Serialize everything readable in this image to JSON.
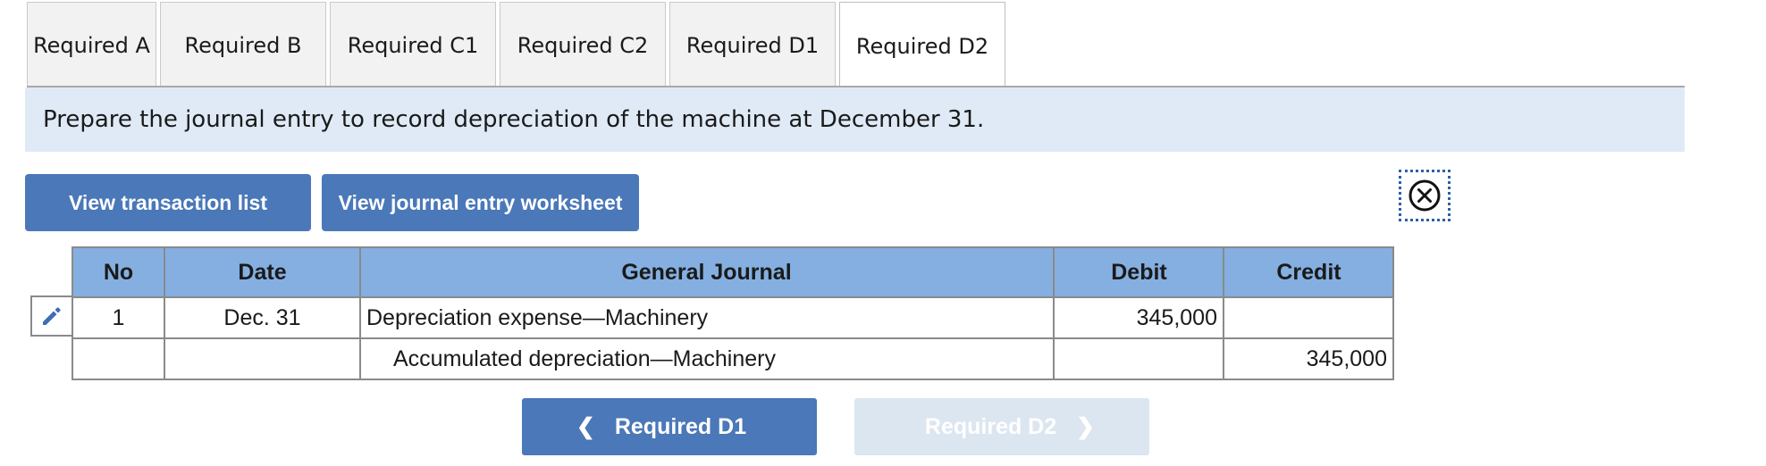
{
  "tabs": [
    {
      "label": "Required A",
      "active": false
    },
    {
      "label": "Required B",
      "active": false
    },
    {
      "label": "Required C1",
      "active": false
    },
    {
      "label": "Required C2",
      "active": false
    },
    {
      "label": "Required D1",
      "active": false
    },
    {
      "label": "Required D2",
      "active": true
    }
  ],
  "instruction": "Prepare the journal entry to record depreciation of the machine at December 31.",
  "buttons": {
    "view_transaction_list": "View transaction list",
    "view_journal_entry_worksheet": "View journal entry worksheet"
  },
  "icons": {
    "close": "close-circle-icon",
    "edit": "pencil-icon",
    "prev": "chevron-left-icon",
    "next": "chevron-right-icon"
  },
  "table": {
    "headers": {
      "no": "No",
      "date": "Date",
      "general_journal": "General Journal",
      "debit": "Debit",
      "credit": "Credit"
    },
    "rows": [
      {
        "no": "1",
        "date": "Dec. 31",
        "account": "Depreciation expense—Machinery",
        "debit": "345,000",
        "credit": ""
      },
      {
        "no": "",
        "date": "",
        "account": "Accumulated depreciation—Machinery",
        "debit": "",
        "credit": "345,000"
      }
    ]
  },
  "nav": {
    "prev_label": "Required D1",
    "next_label": "Required D2",
    "next_enabled": false
  },
  "colors": {
    "accent": "#4a78b8",
    "instruction_bg": "#dfeaf6",
    "header_bg": "#84afe0",
    "disabled_bg": "#dce6f1"
  }
}
